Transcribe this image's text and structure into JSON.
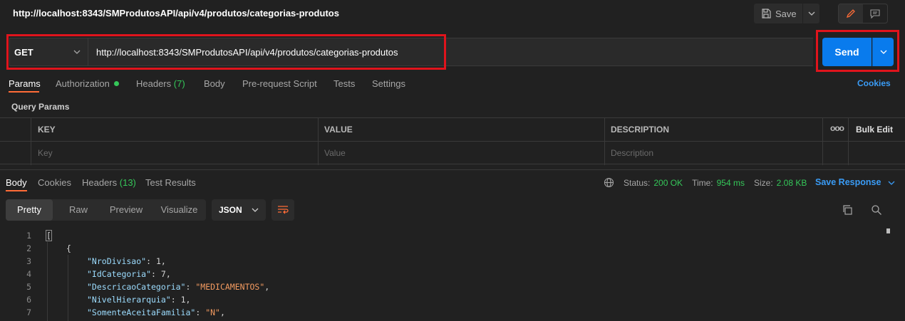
{
  "header": {
    "title": "http://localhost:8343/SMProdutosAPI/api/v4/produtos/categorias-produtos",
    "save_label": "Save"
  },
  "request": {
    "method": "GET",
    "url": "http://localhost:8343/SMProdutosAPI/api/v4/produtos/categorias-produtos",
    "send_label": "Send"
  },
  "request_tabs": {
    "params": "Params",
    "authorization": "Authorization",
    "headers": "Headers",
    "headers_count": "(7)",
    "body": "Body",
    "pre_request": "Pre-request Script",
    "tests": "Tests",
    "settings": "Settings",
    "cookies": "Cookies"
  },
  "query_params": {
    "title": "Query Params",
    "columns": {
      "key": "KEY",
      "value": "VALUE",
      "description": "DESCRIPTION",
      "more": "ooo",
      "bulk_edit": "Bulk Edit"
    },
    "placeholders": {
      "key": "Key",
      "value": "Value",
      "description": "Description"
    }
  },
  "response_tabs": {
    "body": "Body",
    "cookies": "Cookies",
    "headers": "Headers",
    "headers_count": "(13)",
    "test_results": "Test Results"
  },
  "response_status": {
    "status_label": "Status:",
    "status_value": "200 OK",
    "time_label": "Time:",
    "time_value": "954 ms",
    "size_label": "Size:",
    "size_value": "2.08 KB",
    "save_response": "Save Response"
  },
  "view_modes": {
    "pretty": "Pretty",
    "raw": "Raw",
    "preview": "Preview",
    "visualize": "Visualize",
    "format": "JSON"
  },
  "code": {
    "line_numbers": [
      "1",
      "2",
      "3",
      "4",
      "5",
      "6",
      "7"
    ],
    "l1": "[",
    "l2": "{",
    "l3": {
      "key": "\"NroDivisao\"",
      "value": "1"
    },
    "l4": {
      "key": "\"IdCategoria\"",
      "value": "7"
    },
    "l5": {
      "key": "\"DescricaoCategoria\"",
      "value": "\"MEDICAMENTOS\""
    },
    "l6": {
      "key": "\"NivelHierarquia\"",
      "value": "1"
    },
    "l7": {
      "key": "\"SomenteAceitaFamilia\"",
      "value": "\"N\""
    }
  },
  "colors": {
    "accent": "#097bed",
    "tab_underline": "#ff6c37",
    "highlight_box": "#e0141c",
    "status_ok": "#35c759"
  }
}
